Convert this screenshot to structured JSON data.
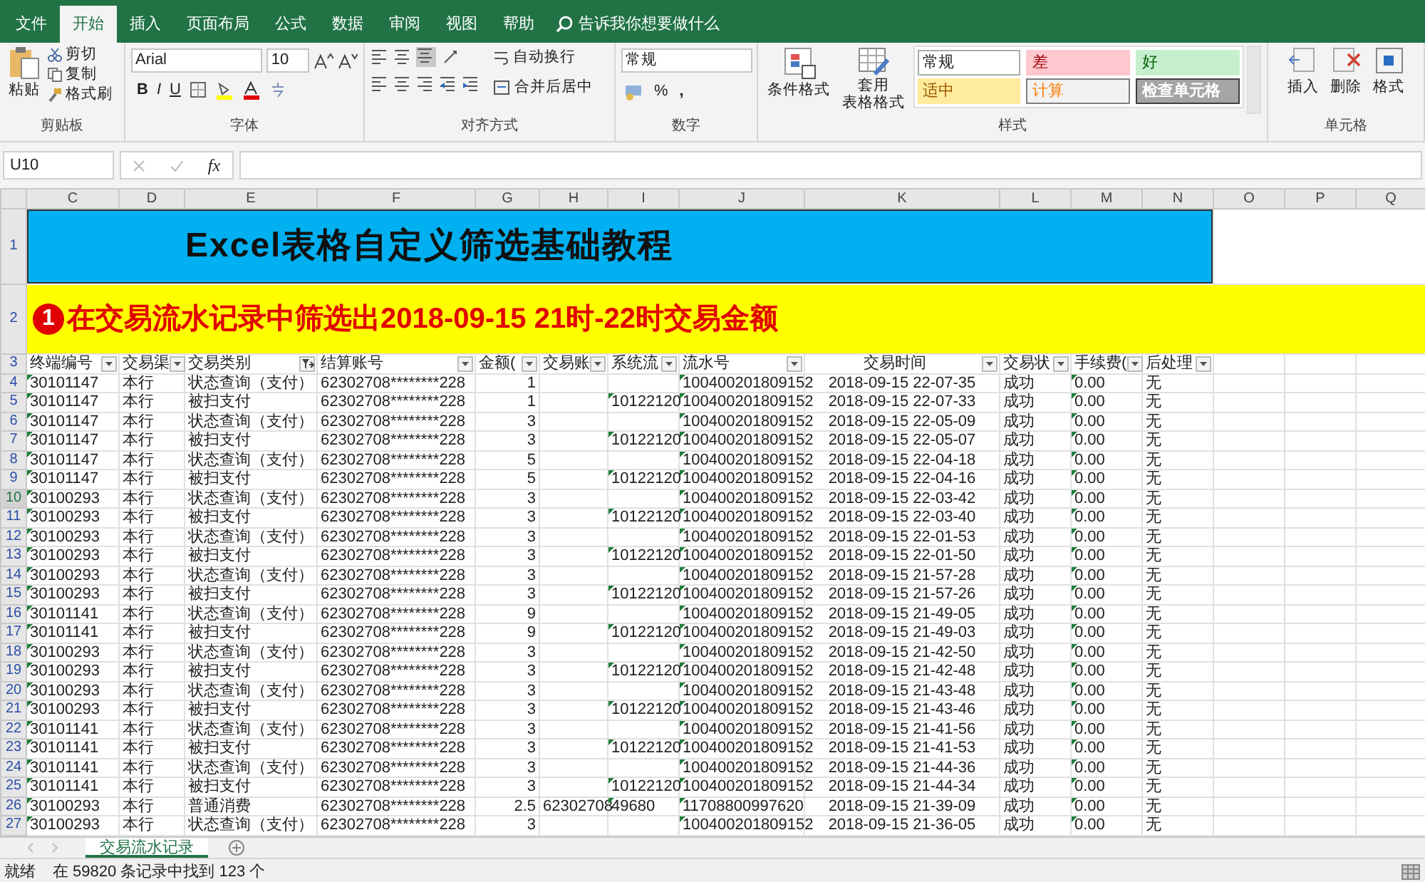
{
  "menu_tabs": [
    {
      "label": "文件",
      "selected": false
    },
    {
      "label": "开始",
      "selected": true
    },
    {
      "label": "插入",
      "selected": false
    },
    {
      "label": "页面布局",
      "selected": false
    },
    {
      "label": "公式",
      "selected": false
    },
    {
      "label": "数据",
      "selected": false
    },
    {
      "label": "审阅",
      "selected": false
    },
    {
      "label": "视图",
      "selected": false
    },
    {
      "label": "帮助",
      "selected": false
    }
  ],
  "tell_me": "告诉我你想要做什么",
  "ribbon": {
    "clipboard": {
      "paste": "粘贴",
      "cut": "剪切",
      "copy": "复制",
      "format_painter": "格式刷",
      "label": "剪贴板"
    },
    "font": {
      "name": "Arial",
      "size": "10",
      "bold": "B",
      "italic": "I",
      "underline": "U",
      "label": "字体"
    },
    "alignment": {
      "wrap": "自动换行",
      "merge": "合并后居中",
      "label": "对齐方式"
    },
    "number": {
      "format": "常规",
      "percent": "%",
      "comma": ",",
      "label": "数字"
    },
    "styles": {
      "conditional": "条件格式",
      "table_format": [
        "套用",
        "表格格式"
      ],
      "label": "样式",
      "gallery": [
        {
          "label": "常规",
          "kind": "normal"
        },
        {
          "label": "差",
          "kind": "bad"
        },
        {
          "label": "好",
          "kind": "good"
        },
        {
          "label": "适中",
          "kind": "neutral"
        },
        {
          "label": "计算",
          "kind": "calc"
        },
        {
          "label": "检查单元格",
          "kind": "check"
        }
      ]
    },
    "cells": {
      "buttons": [
        "插入",
        "删除",
        "格式"
      ],
      "label": "单元格"
    }
  },
  "formula_bar": {
    "name_box": "U10",
    "fx": "fx"
  },
  "sheet": {
    "top_rows": [
      "1",
      "2",
      "3"
    ],
    "title": "Excel表格自定义筛选基础教程",
    "subtitle": {
      "badge": "1",
      "text": "在交易流水记录中筛选出2018-09-15 21时-22时交易金额"
    },
    "columns": [
      {
        "letter": "C",
        "header": "终端编号",
        "kind": "text",
        "filter_applied": false,
        "flagged": true
      },
      {
        "letter": "D",
        "header": "交易渠",
        "kind": "text",
        "filter_applied": false
      },
      {
        "letter": "E",
        "header": "交易类别",
        "kind": "text",
        "filter_applied": true
      },
      {
        "letter": "F",
        "header": "结算账号",
        "kind": "text",
        "filter_applied": false
      },
      {
        "letter": "G",
        "header": "金额(",
        "kind": "number",
        "filter_applied": false
      },
      {
        "letter": "H",
        "header": "交易账",
        "kind": "text",
        "filter_applied": false
      },
      {
        "letter": "I",
        "header": "系统流",
        "kind": "text",
        "filter_applied": false,
        "flagged": true
      },
      {
        "letter": "J",
        "header": "流水号",
        "kind": "text",
        "filter_applied": false,
        "flagged": true
      },
      {
        "letter": "K",
        "header": "交易时间",
        "kind": "datetime",
        "filter_applied": false
      },
      {
        "letter": "L",
        "header": "交易状",
        "kind": "text",
        "filter_applied": false
      },
      {
        "letter": "M",
        "header": "手续费(",
        "kind": "text",
        "filter_applied": false,
        "flagged": true
      },
      {
        "letter": "N",
        "header": "后处理",
        "kind": "text",
        "filter_applied": false
      },
      {
        "letter": "O"
      },
      {
        "letter": "P"
      },
      {
        "letter": "Q"
      }
    ],
    "rows": [
      {
        "n": "4",
        "selected": false,
        "cells": [
          "30101147",
          "本行",
          "状态查询（支付）",
          "62302708********228",
          "1",
          null,
          null,
          "100400201809152",
          "2018-09-15 22-07-35",
          "成功",
          "0.00",
          "无"
        ]
      },
      {
        "n": "5",
        "selected": false,
        "cells": [
          "30101147",
          "本行",
          "被扫支付",
          "62302708********228",
          "1",
          null,
          "10122120",
          "100400201809152",
          "2018-09-15 22-07-33",
          "成功",
          "0.00",
          "无"
        ]
      },
      {
        "n": "6",
        "selected": false,
        "cells": [
          "30101147",
          "本行",
          "状态查询（支付）",
          "62302708********228",
          "3",
          null,
          null,
          "100400201809152",
          "2018-09-15 22-05-09",
          "成功",
          "0.00",
          "无"
        ]
      },
      {
        "n": "7",
        "selected": false,
        "cells": [
          "30101147",
          "本行",
          "被扫支付",
          "62302708********228",
          "3",
          null,
          "10122120",
          "100400201809152",
          "2018-09-15 22-05-07",
          "成功",
          "0.00",
          "无"
        ]
      },
      {
        "n": "8",
        "selected": false,
        "cells": [
          "30101147",
          "本行",
          "状态查询（支付）",
          "62302708********228",
          "5",
          null,
          null,
          "100400201809152",
          "2018-09-15 22-04-18",
          "成功",
          "0.00",
          "无"
        ]
      },
      {
        "n": "9",
        "selected": false,
        "cells": [
          "30101147",
          "本行",
          "被扫支付",
          "62302708********228",
          "5",
          null,
          "10122120",
          "100400201809152",
          "2018-09-15 22-04-16",
          "成功",
          "0.00",
          "无"
        ]
      },
      {
        "n": "10",
        "selected": true,
        "cells": [
          "30100293",
          "本行",
          "状态查询（支付）",
          "62302708********228",
          "3",
          null,
          null,
          "100400201809152",
          "2018-09-15 22-03-42",
          "成功",
          "0.00",
          "无"
        ]
      },
      {
        "n": "11",
        "selected": false,
        "cells": [
          "30100293",
          "本行",
          "被扫支付",
          "62302708********228",
          "3",
          null,
          "10122120",
          "100400201809152",
          "2018-09-15 22-03-40",
          "成功",
          "0.00",
          "无"
        ]
      },
      {
        "n": "12",
        "selected": false,
        "cells": [
          "30100293",
          "本行",
          "状态查询（支付）",
          "62302708********228",
          "3",
          null,
          null,
          "100400201809152",
          "2018-09-15 22-01-53",
          "成功",
          "0.00",
          "无"
        ]
      },
      {
        "n": "13",
        "selected": false,
        "cells": [
          "30100293",
          "本行",
          "被扫支付",
          "62302708********228",
          "3",
          null,
          "10122120",
          "100400201809152",
          "2018-09-15 22-01-50",
          "成功",
          "0.00",
          "无"
        ]
      },
      {
        "n": "14",
        "selected": false,
        "cells": [
          "30100293",
          "本行",
          "状态查询（支付）",
          "62302708********228",
          "3",
          null,
          null,
          "100400201809152",
          "2018-09-15 21-57-28",
          "成功",
          "0.00",
          "无"
        ]
      },
      {
        "n": "15",
        "selected": false,
        "cells": [
          "30100293",
          "本行",
          "被扫支付",
          "62302708********228",
          "3",
          null,
          "10122120",
          "100400201809152",
          "2018-09-15 21-57-26",
          "成功",
          "0.00",
          "无"
        ]
      },
      {
        "n": "16",
        "selected": false,
        "cells": [
          "30101141",
          "本行",
          "状态查询（支付）",
          "62302708********228",
          "9",
          null,
          null,
          "100400201809152",
          "2018-09-15 21-49-05",
          "成功",
          "0.00",
          "无"
        ]
      },
      {
        "n": "17",
        "selected": false,
        "cells": [
          "30101141",
          "本行",
          "被扫支付",
          "62302708********228",
          "9",
          null,
          "10122120",
          "100400201809152",
          "2018-09-15 21-49-03",
          "成功",
          "0.00",
          "无"
        ]
      },
      {
        "n": "18",
        "selected": false,
        "cells": [
          "30100293",
          "本行",
          "状态查询（支付）",
          "62302708********228",
          "3",
          null,
          null,
          "100400201809152",
          "2018-09-15 21-42-50",
          "成功",
          "0.00",
          "无"
        ]
      },
      {
        "n": "19",
        "selected": false,
        "cells": [
          "30100293",
          "本行",
          "被扫支付",
          "62302708********228",
          "3",
          null,
          "10122120",
          "100400201809152",
          "2018-09-15 21-42-48",
          "成功",
          "0.00",
          "无"
        ]
      },
      {
        "n": "20",
        "selected": false,
        "cells": [
          "30100293",
          "本行",
          "状态查询（支付）",
          "62302708********228",
          "3",
          null,
          null,
          "100400201809152",
          "2018-09-15 21-43-48",
          "成功",
          "0.00",
          "无"
        ]
      },
      {
        "n": "21",
        "selected": false,
        "cells": [
          "30100293",
          "本行",
          "被扫支付",
          "62302708********228",
          "3",
          null,
          "10122120",
          "100400201809152",
          "2018-09-15 21-43-46",
          "成功",
          "0.00",
          "无"
        ]
      },
      {
        "n": "22",
        "selected": false,
        "cells": [
          "30101141",
          "本行",
          "状态查询（支付）",
          "62302708********228",
          "3",
          null,
          null,
          "100400201809152",
          "2018-09-15 21-41-56",
          "成功",
          "0.00",
          "无"
        ]
      },
      {
        "n": "23",
        "selected": false,
        "cells": [
          "30101141",
          "本行",
          "被扫支付",
          "62302708********228",
          "3",
          null,
          "10122120",
          "100400201809152",
          "2018-09-15 21-41-53",
          "成功",
          "0.00",
          "无"
        ]
      },
      {
        "n": "24",
        "selected": false,
        "cells": [
          "30101141",
          "本行",
          "状态查询（支付）",
          "62302708********228",
          "3",
          null,
          null,
          "100400201809152",
          "2018-09-15 21-44-36",
          "成功",
          "0.00",
          "无"
        ]
      },
      {
        "n": "25",
        "selected": false,
        "cells": [
          "30101141",
          "本行",
          "被扫支付",
          "62302708********228",
          "3",
          null,
          "10122120",
          "100400201809152",
          "2018-09-15 21-44-34",
          "成功",
          "0.00",
          "无"
        ]
      },
      {
        "n": "26",
        "selected": false,
        "cells": [
          "30100293",
          "本行",
          "普通消费",
          "62302708********228",
          "2.5",
          "62302708",
          "49680",
          "11708800997620",
          "2018-09-15 21-39-09",
          "成功",
          "0.00",
          "无"
        ]
      },
      {
        "n": "27",
        "selected": false,
        "cells": [
          "30100293",
          "本行",
          "状态查询（支付）",
          "62302708********228",
          "3",
          null,
          null,
          "100400201809152",
          "2018-09-15 21-36-05",
          "成功",
          "0.00",
          "无"
        ]
      }
    ]
  },
  "sheet_tabs": [
    {
      "label": "交易流水记录",
      "selected": true
    }
  ],
  "status_bar": {
    "mode": "就绪",
    "message": "在 59820 条记录中找到 123 个"
  }
}
